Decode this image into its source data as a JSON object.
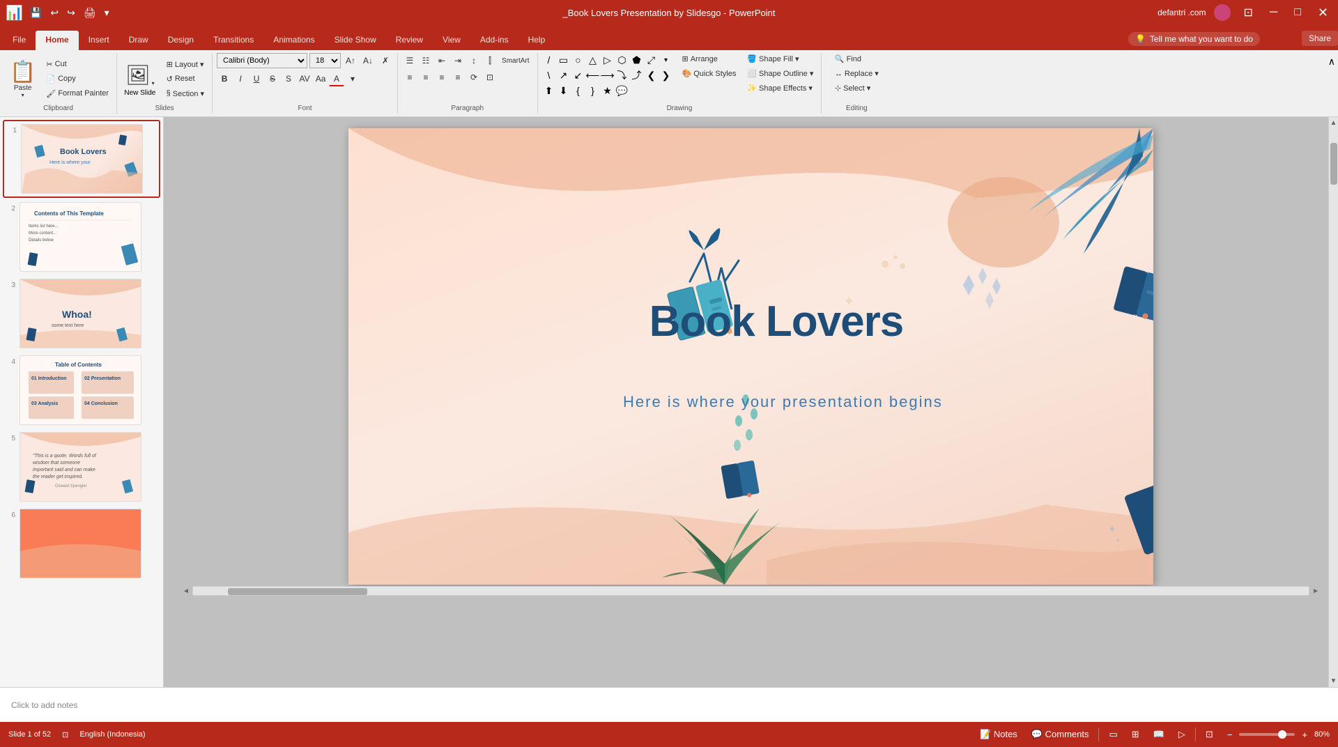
{
  "titleBar": {
    "title": "_Book Lovers Presentation by Slidesgo - PowerPoint",
    "user": "defantri .com",
    "quickAccess": [
      "💾",
      "↩",
      "↪",
      "🖨",
      "▾"
    ]
  },
  "tabs": [
    {
      "label": "File",
      "active": false
    },
    {
      "label": "Home",
      "active": true
    },
    {
      "label": "Insert",
      "active": false
    },
    {
      "label": "Draw",
      "active": false
    },
    {
      "label": "Design",
      "active": false
    },
    {
      "label": "Transitions",
      "active": false
    },
    {
      "label": "Animations",
      "active": false
    },
    {
      "label": "Slide Show",
      "active": false
    },
    {
      "label": "Review",
      "active": false
    },
    {
      "label": "View",
      "active": false
    },
    {
      "label": "Add-ins",
      "active": false
    },
    {
      "label": "Help",
      "active": false
    }
  ],
  "tellMe": "Tell me what you want to do",
  "shareBtn": "Share",
  "ribbon": {
    "clipboard": {
      "label": "Clipboard",
      "paste": "Paste",
      "cut": "Cut",
      "copy": "Copy",
      "formatPainter": "Format Painter"
    },
    "slides": {
      "label": "Slides",
      "newSlide": "New Slide",
      "layout": "Layout ▾",
      "reset": "Reset",
      "section": "Section ▾"
    },
    "font": {
      "label": "Font",
      "fontName": "Calibri (Body)",
      "fontSize": "18",
      "bold": "B",
      "italic": "I",
      "underline": "U",
      "strikethrough": "S",
      "shadow": "S",
      "charSpacing": "AV",
      "case": "Aa",
      "fontColor": "A",
      "clearFormatting": "✗",
      "incSize": "A↑",
      "decSize": "A↓"
    },
    "paragraph": {
      "label": "Paragraph",
      "bullets": "☰",
      "numbering": "☷",
      "decIndent": "⇤",
      "incIndent": "⇥",
      "lineSpacing": "↕",
      "addRemoveColumns": "⫿",
      "alignLeft": "≡",
      "alignCenter": "≡",
      "alignRight": "≡",
      "justify": "≡",
      "textDirection": "⟳",
      "alignText": "⊡",
      "smartArt": "SmartArt"
    },
    "drawing": {
      "label": "Drawing",
      "shapes": [
        "▭",
        "○",
        "△",
        "▷",
        "⬡",
        "⬟",
        "⤢",
        "/",
        "\\",
        "↗",
        "↙",
        "⟵",
        "⟶",
        "⤵",
        "⤴",
        "❮",
        "❯",
        "⬆",
        "⬇",
        "▾"
      ],
      "arrange": "Arrange",
      "quickStyles": "Quick Styles",
      "shapeFill": "Shape Fill ▾",
      "shapeOutline": "Shape Outline ▾",
      "shapeEffects": "Shape Effects ▾"
    },
    "editing": {
      "label": "Editing",
      "find": "Find",
      "replace": "Replace ▾",
      "select": "Select ▾"
    }
  },
  "slides": [
    {
      "number": "1",
      "active": true,
      "type": "title"
    },
    {
      "number": "2",
      "active": false,
      "type": "contents"
    },
    {
      "number": "3",
      "active": false,
      "type": "whoa"
    },
    {
      "number": "4",
      "active": false,
      "type": "toc"
    },
    {
      "number": "5",
      "active": false,
      "type": "quote"
    },
    {
      "number": "6",
      "active": false,
      "type": "orange"
    }
  ],
  "mainSlide": {
    "title": "Book Lovers",
    "subtitle": "Here is where your presentation begins"
  },
  "notesPlaceholder": "Click to add notes",
  "statusBar": {
    "slideInfo": "Slide 1 of 52",
    "language": "English (Indonesia)",
    "notesBtn": "Notes",
    "commentsBtn": "Comments",
    "zoomLevel": "80%"
  }
}
